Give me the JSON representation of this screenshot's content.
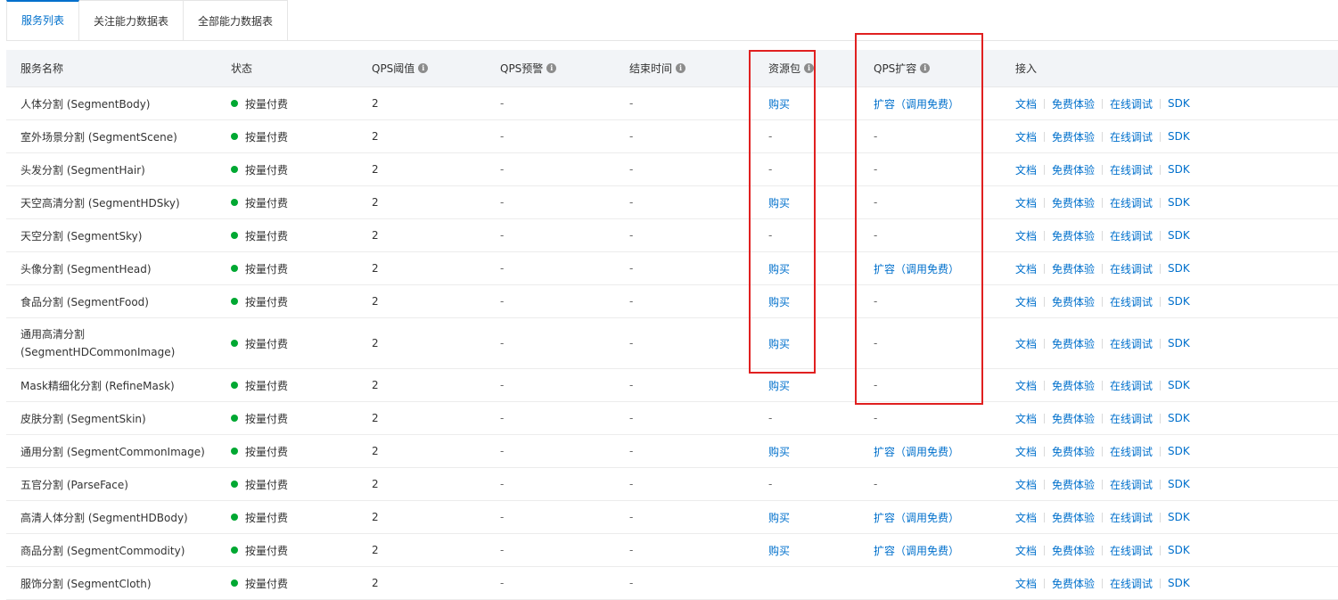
{
  "tabs": [
    "服务列表",
    "关注能力数据表",
    "全部能力数据表"
  ],
  "columns": {
    "name": "服务名称",
    "status": "状态",
    "qps_threshold": "QPS阈值",
    "qps_alert": "QPS预警",
    "end_time": "结束时间",
    "package": "资源包",
    "qps_expand": "QPS扩容",
    "access": "接入"
  },
  "access_links": [
    "文档",
    "免费体验",
    "在线调试",
    "SDK"
  ],
  "rows": [
    {
      "name": "人体分割 (SegmentBody)",
      "status": "按量付费",
      "qps": "2",
      "alert": "-",
      "end": "-",
      "package": "购买",
      "expand": "扩容（调用免费）"
    },
    {
      "name": "室外场景分割 (SegmentScene)",
      "status": "按量付费",
      "qps": "2",
      "alert": "-",
      "end": "-",
      "package": "-",
      "expand": "-"
    },
    {
      "name": "头发分割 (SegmentHair)",
      "status": "按量付费",
      "qps": "2",
      "alert": "-",
      "end": "-",
      "package": "-",
      "expand": "-"
    },
    {
      "name": "天空高清分割 (SegmentHDSky)",
      "status": "按量付费",
      "qps": "2",
      "alert": "-",
      "end": "-",
      "package": "购买",
      "expand": "-"
    },
    {
      "name": "天空分割 (SegmentSky)",
      "status": "按量付费",
      "qps": "2",
      "alert": "-",
      "end": "-",
      "package": "-",
      "expand": "-"
    },
    {
      "name": "头像分割 (SegmentHead)",
      "status": "按量付费",
      "qps": "2",
      "alert": "-",
      "end": "-",
      "package": "购买",
      "expand": "扩容（调用免费）"
    },
    {
      "name": "食品分割 (SegmentFood)",
      "status": "按量付费",
      "qps": "2",
      "alert": "-",
      "end": "-",
      "package": "购买",
      "expand": "-"
    },
    {
      "name": "通用高清分割 (SegmentHDCommonImage)",
      "status": "按量付费",
      "qps": "2",
      "alert": "-",
      "end": "-",
      "package": "购买",
      "expand": "-"
    },
    {
      "name": "Mask精细化分割 (RefineMask)",
      "status": "按量付费",
      "qps": "2",
      "alert": "-",
      "end": "-",
      "package": "购买",
      "expand": "-"
    },
    {
      "name": "皮肤分割 (SegmentSkin)",
      "status": "按量付费",
      "qps": "2",
      "alert": "-",
      "end": "-",
      "package": "-",
      "expand": "-"
    },
    {
      "name": "通用分割 (SegmentCommonImage)",
      "status": "按量付费",
      "qps": "2",
      "alert": "-",
      "end": "-",
      "package": "购买",
      "expand": "扩容（调用免费）"
    },
    {
      "name": "五官分割 (ParseFace)",
      "status": "按量付费",
      "qps": "2",
      "alert": "-",
      "end": "-",
      "package": "-",
      "expand": "-"
    },
    {
      "name": "高清人体分割 (SegmentHDBody)",
      "status": "按量付费",
      "qps": "2",
      "alert": "-",
      "end": "-",
      "package": "购买",
      "expand": "扩容（调用免费）"
    },
    {
      "name": "商品分割 (SegmentCommodity)",
      "status": "按量付费",
      "qps": "2",
      "alert": "-",
      "end": "-",
      "package": "购买",
      "expand": "扩容（调用免费）"
    },
    {
      "name": "服饰分割 (SegmentCloth)",
      "status": "按量付费",
      "qps": "2",
      "alert": "-",
      "end": "-",
      "package": "",
      "expand": ""
    }
  ],
  "colors": {
    "accent": "#0070cc",
    "status_dot": "#00a832",
    "highlight": "#e02020"
  }
}
